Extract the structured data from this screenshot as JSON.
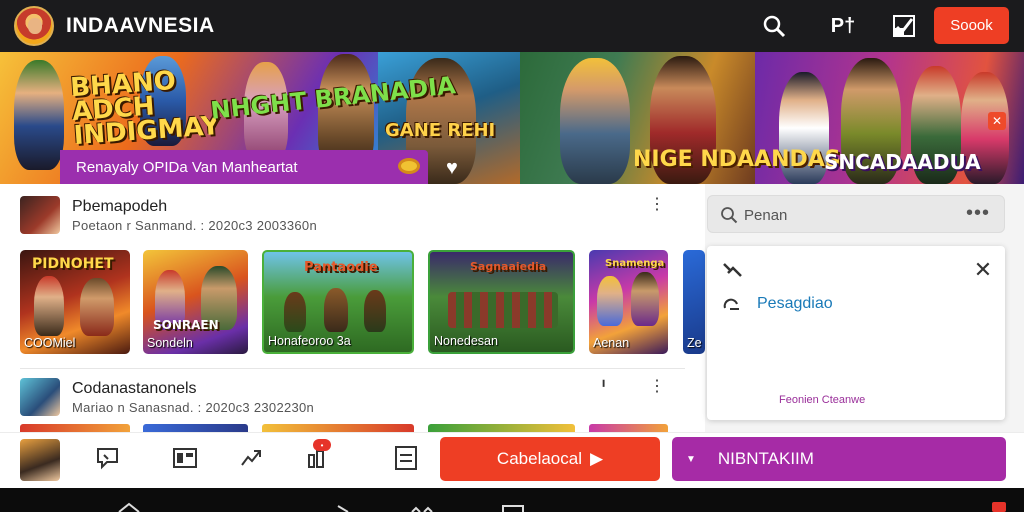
{
  "app": {
    "title": "INDAAVNESIA",
    "signin_label": "Soook",
    "top_icon_text": "P†"
  },
  "banner": {
    "titles": [
      "BHANO ADCH INDIGMAY",
      "NHGHT BRANADIA",
      "GANE REHI",
      "NIGE NDAANDAS",
      "SNCADAADUA"
    ],
    "promo_text": "Renayaly OPIDa Van Manheartat"
  },
  "sections": [
    {
      "title": "Pbemapodeh",
      "subtitle": "Poetaon r Sanmand. :   2020c3 2003360n"
    },
    {
      "title": "Codanastanonels",
      "subtitle": "Mariao n Sanasnad. :   2020c3 2302230n"
    }
  ],
  "tiles": [
    {
      "title": "PIDNOHET",
      "label": "COOMiel"
    },
    {
      "title": "SONRAEN",
      "label": "Sondeln"
    },
    {
      "title": "Pantaodie",
      "label": "Honafeoroo 3a"
    },
    {
      "title": "Sagnaaiedia",
      "label": "Nonedesan"
    },
    {
      "title": "Snamenga",
      "label": "Aenan"
    },
    {
      "title": "",
      "label": "Ze"
    }
  ],
  "search": {
    "placeholder": "Penan"
  },
  "popup": {
    "link": "Pesagdiao",
    "footer": "Feonien Cteanwe"
  },
  "actions": {
    "badge": "??",
    "orange_label": "Cabelaocal",
    "purple_label": "NIBNTAKIIM"
  },
  "icons": [
    "search-icon",
    "check-icon",
    "signin-button",
    "chat-icon",
    "film-icon",
    "share-icon",
    "building-icon",
    "document-icon",
    "play-icon",
    "chevron-down-icon",
    "close-icon",
    "link-icon",
    "tool-icon"
  ],
  "colors": {
    "topbar": "#1b1b1d",
    "accent_orange": "#ee3e24",
    "accent_purple": "#a62ba6",
    "promo_purple": "#9b2fae",
    "link_blue": "#1a7ab8"
  }
}
